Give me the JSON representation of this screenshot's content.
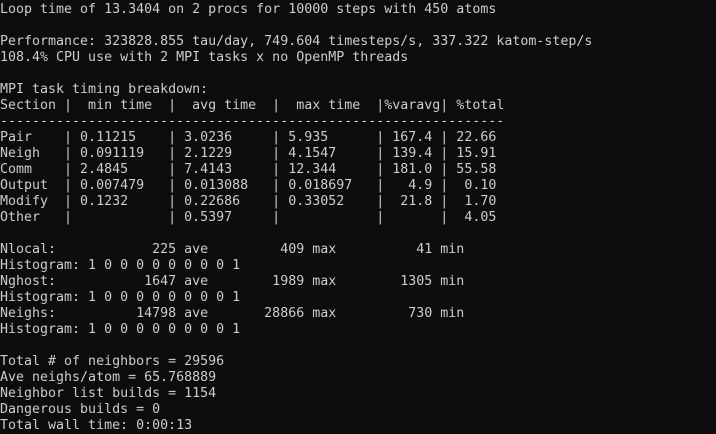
{
  "terminal": {
    "lines": [
      "Loop time of 13.3404 on 2 procs for 10000 steps with 450 atoms",
      "",
      "Performance: 323828.855 tau/day, 749.604 timesteps/s, 337.322 katom-step/s",
      "108.4% CPU use with 2 MPI tasks x no OpenMP threads",
      "",
      "MPI task timing breakdown:",
      "Section |  min time  |  avg time  |  max time  |%varavg| %total",
      "---------------------------------------------------------------",
      "Pair    | 0.11215    | 3.0236     | 5.935      | 167.4 | 22.66",
      "Neigh   | 0.091119   | 2.1229     | 4.1547     | 139.4 | 15.91",
      "Comm    | 2.4845     | 7.4143     | 12.344     | 181.0 | 55.58",
      "Output  | 0.007479   | 0.013088   | 0.018697   |   4.9 |  0.10",
      "Modify  | 0.1232     | 0.22686    | 0.33052    |  21.8 |  1.70",
      "Other   |            | 0.5397     |            |       |  4.05",
      "",
      "Nlocal:            225 ave         409 max          41 min",
      "Histogram: 1 0 0 0 0 0 0 0 0 1",
      "Nghost:           1647 ave        1989 max        1305 min",
      "Histogram: 1 0 0 0 0 0 0 0 0 1",
      "Neighs:          14798 ave       28866 max         730 min",
      "Histogram: 1 0 0 0 0 0 0 0 0 1",
      "",
      "Total # of neighbors = 29596",
      "Ave neighs/atom = 65.768889",
      "Neighbor list builds = 1154",
      "Dangerous builds = 0",
      "Total wall time: 0:00:13"
    ]
  }
}
